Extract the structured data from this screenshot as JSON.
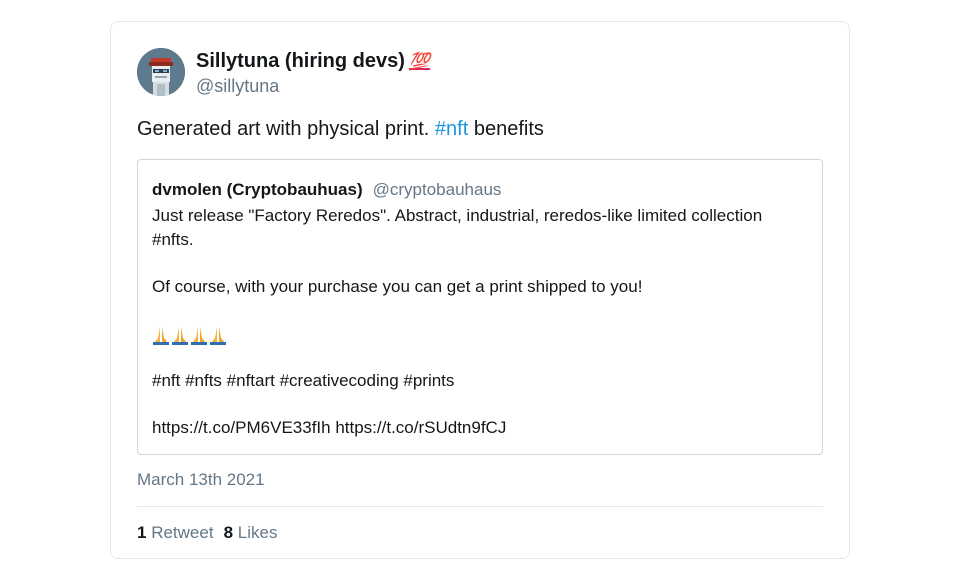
{
  "tweet": {
    "author": {
      "display_name": "Sillytuna (hiring devs)",
      "badge_emoji": "💯",
      "handle": "@sillytuna",
      "avatar_icon": "pixel-art-avatar"
    },
    "text": {
      "before": "Generated art with physical print. ",
      "hashtag": "#nft",
      "after": " benefits"
    },
    "quoted": {
      "display_name": "dvmolen (Cryptobauhuas)",
      "handle": "@cryptobauhaus",
      "line1": "Just release \"Factory Reredos\".  Abstract, industrial, reredos-like limited collection #nfts.",
      "line2": "Of course, with your purchase you can get a print shipped to you!",
      "emoji_icon": "folded-hands",
      "emoji_count": 4,
      "hashtags_line": "#nft #nfts #nftart #creativecoding #prints",
      "links_line": "https://t.co/PM6VE33fIh https://t.co/rSUdtn9fCJ"
    },
    "date": "March 13th 2021",
    "stats": {
      "retweet_count": "1",
      "retweet_label": "Retweet",
      "likes_count": "8",
      "likes_label": "Likes"
    }
  },
  "colors": {
    "hashtag": "#1b95e0",
    "secondary_text": "#657786",
    "border": "#e1e8ed",
    "badge": "#e0245e"
  }
}
